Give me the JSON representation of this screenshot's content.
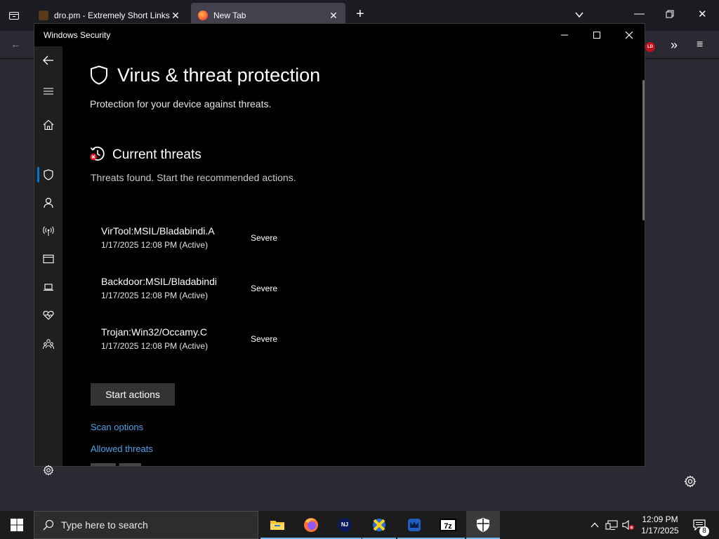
{
  "browser": {
    "tabs": [
      {
        "title": "dro.pm - Extremely Short Links",
        "active": false
      },
      {
        "title": "New Tab",
        "active": true
      }
    ],
    "new_tab_symbol": "+",
    "ext_badge": "LD"
  },
  "window": {
    "title": "Windows Security"
  },
  "page": {
    "title": "Virus & threat protection",
    "subtitle": "Protection for your device against threats.",
    "section_title": "Current threats",
    "section_desc": "Threats found. Start the recommended actions.",
    "threats": [
      {
        "name": "VirTool:MSIL/Bladabindi.A",
        "time": "1/17/2025 12:08 PM (Active)",
        "severity": "Severe"
      },
      {
        "name": "Backdoor:MSIL/Bladabindi",
        "time": "1/17/2025 12:08 PM (Active)",
        "severity": "Severe"
      },
      {
        "name": "Trojan:Win32/Occamy.C",
        "time": "1/17/2025 12:08 PM (Active)",
        "severity": "Severe"
      }
    ],
    "start_actions_label": "Start actions",
    "links": [
      "Scan options",
      "Allowed threats"
    ]
  },
  "nav_icons": [
    "back-arrow-icon",
    "hamburger-icon",
    "home-icon",
    "shield-icon",
    "person-icon",
    "wireless-icon",
    "app-browser-icon",
    "laptop-icon",
    "heart-pulse-icon",
    "family-icon",
    "gear-icon"
  ],
  "taskbar": {
    "search_placeholder": "Type here to search",
    "apps": [
      "file-explorer",
      "firefox",
      "njrat",
      "tool-x",
      "tool-crown",
      "7zip",
      "windows-security"
    ],
    "seven_zip_label": "7z",
    "njrat_label": "NJ",
    "time": "12:09 PM",
    "date": "1/17/2025",
    "notification_count": "8"
  },
  "colors": {
    "accent": "#0078d4",
    "link": "#4ca3e6",
    "danger": "#e81123"
  }
}
